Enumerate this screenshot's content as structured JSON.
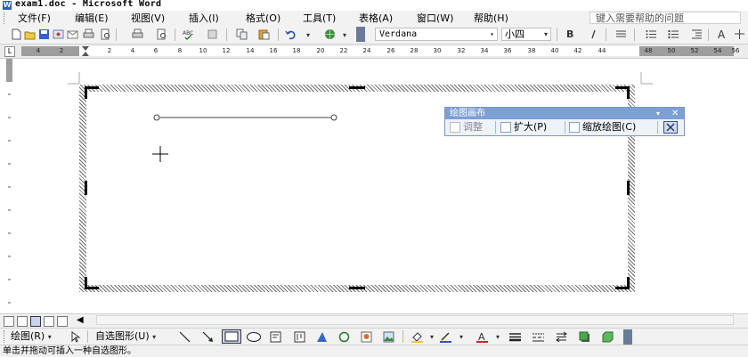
{
  "window": {
    "title": "exam1.doc - Microsoft Word"
  },
  "menu": {
    "items": [
      "文件(F)",
      "编辑(E)",
      "视图(V)",
      "插入(I)",
      "格式(O)",
      "工具(T)",
      "表格(A)",
      "窗口(W)",
      "帮助(H)"
    ],
    "help_placeholder": "键入需要帮助的问题"
  },
  "format": {
    "font_name": "Verdana",
    "font_size": "小四",
    "bold": "B",
    "font_color_letter": "A"
  },
  "ruler": {
    "labels": [
      "4",
      "2",
      "2",
      "4",
      "6",
      "8",
      "10",
      "12",
      "14",
      "16",
      "18",
      "20",
      "22",
      "24",
      "26",
      "28",
      "30",
      "32",
      "34",
      "36",
      "38",
      "40",
      "42",
      "44",
      "48",
      "50",
      "52",
      "54",
      "56"
    ]
  },
  "canvas_toolbar": {
    "title": "绘图画布",
    "fit": "调整",
    "expand": "扩大(P)",
    "scale": "缩放绘图(C)"
  },
  "draw_toolbar": {
    "draw": "绘图(R)",
    "autoshapes": "自选图形(U)"
  },
  "status": {
    "text": "单击并拖动可插入一种自选图形。"
  }
}
